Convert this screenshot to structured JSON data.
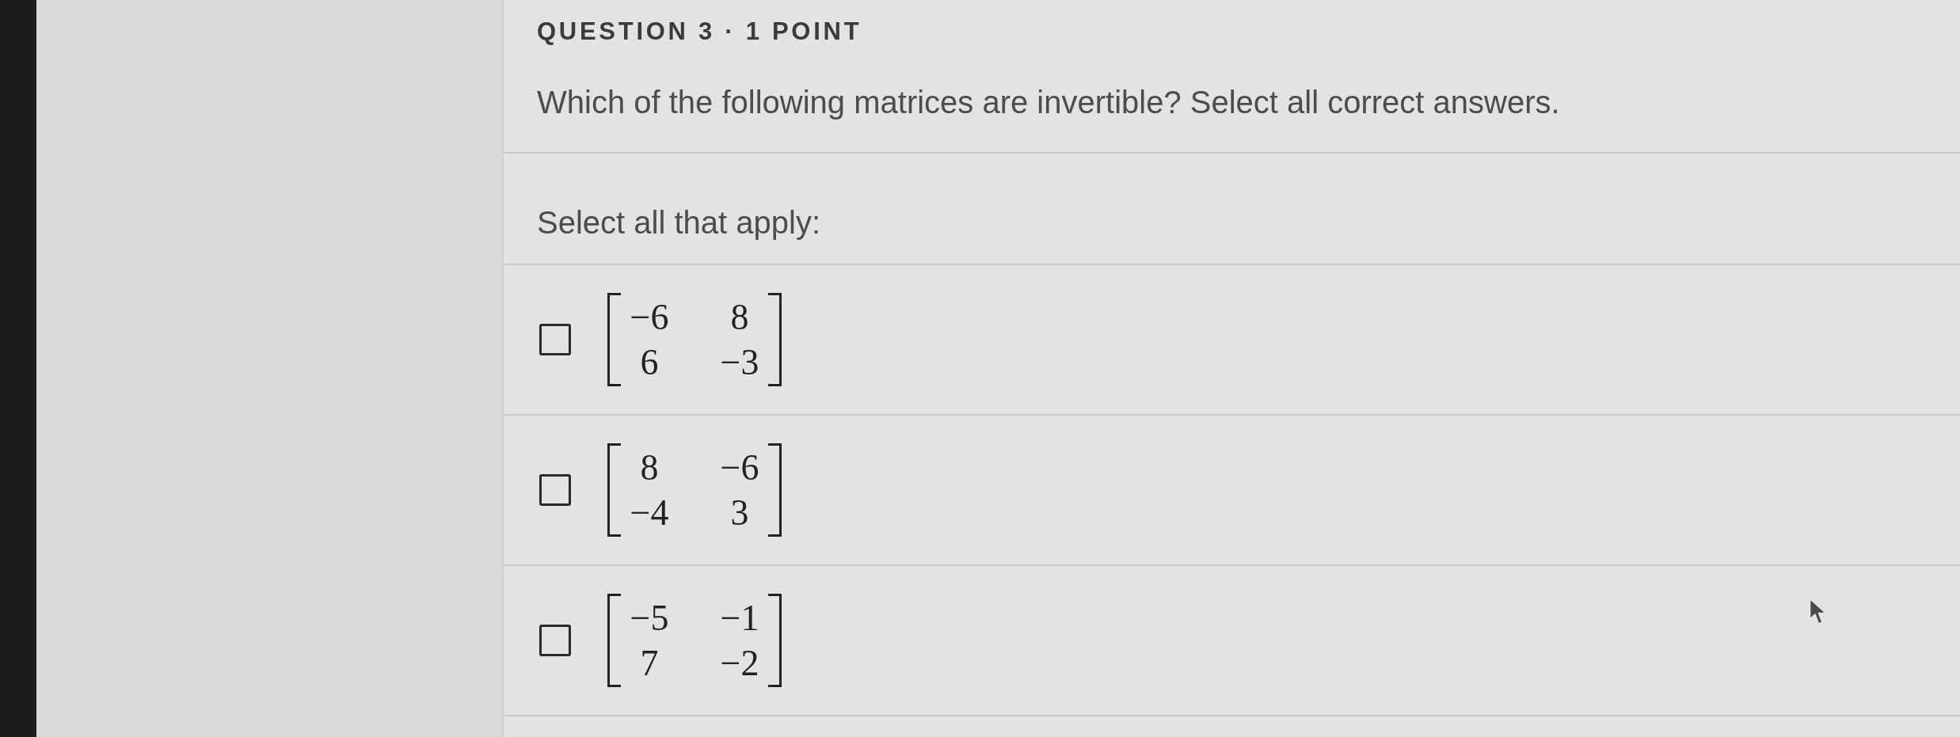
{
  "question": {
    "heading": "QUESTION 3 · 1 POINT",
    "prompt": "Which of the following matrices are invertible? Select all correct answers.",
    "instruction": "Select all that apply:",
    "options": [
      {
        "kind": "matrix",
        "checked": false,
        "rows": [
          [
            "−6",
            "8"
          ],
          [
            "6",
            "−3"
          ]
        ]
      },
      {
        "kind": "matrix",
        "checked": false,
        "rows": [
          [
            "8",
            "−6"
          ],
          [
            "−4",
            "3"
          ]
        ]
      },
      {
        "kind": "matrix",
        "checked": false,
        "rows": [
          [
            "−5",
            "−1"
          ],
          [
            "7",
            "−2"
          ]
        ]
      }
    ]
  }
}
